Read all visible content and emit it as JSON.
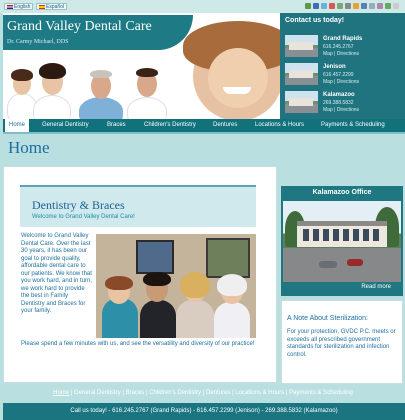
{
  "languages": {
    "english": "English",
    "espanol": "Español"
  },
  "header": {
    "title": "Grand Valley Dental Care",
    "subtitle": "Dr. Carmy Michael, DDS"
  },
  "contact": {
    "title": "Contact us today!",
    "offices": [
      {
        "name": "Grand Rapids",
        "phone": "616.245.2767",
        "links": "Map | Directions"
      },
      {
        "name": "Jenison",
        "phone": "616.457.2299",
        "links": "Map | Directions"
      },
      {
        "name": "Kalamazoo",
        "phone": "269.388.5832",
        "links": "Map | Directions"
      }
    ]
  },
  "nav": [
    "Home",
    "General Dentistry",
    "Braces",
    "Children's Dentistry",
    "Dentures",
    "Locations & Hours",
    "Payments & Scheduling"
  ],
  "page_title": "Home",
  "main": {
    "banner_heading": "Dentistry & Braces",
    "banner_sub": "Welcome to Grand Valley Dental Care!",
    "intro": "Welcome to Grand Valley Dental Care. Over the last 30 years, it has been our goal to provide quality, affordable dental care to our patients. We know that you work hard, and in turn, we work hard to provide the best in Family Dentistry and Braces for your family.",
    "outro": "Please spend a few minutes with us, and see the versatility and diversity of our practice!"
  },
  "sidebar": {
    "office_title": "Kalamazoo Office",
    "read_more": "Read more",
    "sterilization_heading": "A Note About Sterilization:",
    "sterilization_text": "For your protection, GVDC P.C. meets or exceeds all prescribed government standards for sterilization and infection control."
  },
  "footer": {
    "links": [
      "Home",
      "General Dentistry",
      "Braces",
      "Children's Dentistry",
      "Dentures",
      "Locations & Hours",
      "Payments & Scheduling"
    ],
    "call": "Call us today! - 616.245.2767 (Grand Rapids) - 616.457.2299 (Jenison) - 269.388.5832 (Kalamazoo)"
  },
  "colors": {
    "accent": "#1e7b86",
    "link": "#1e6f9f",
    "background": "#b9dfe0"
  },
  "icons": [
    "share-icon",
    "print-icon",
    "email-icon",
    "bookmark-icon"
  ]
}
